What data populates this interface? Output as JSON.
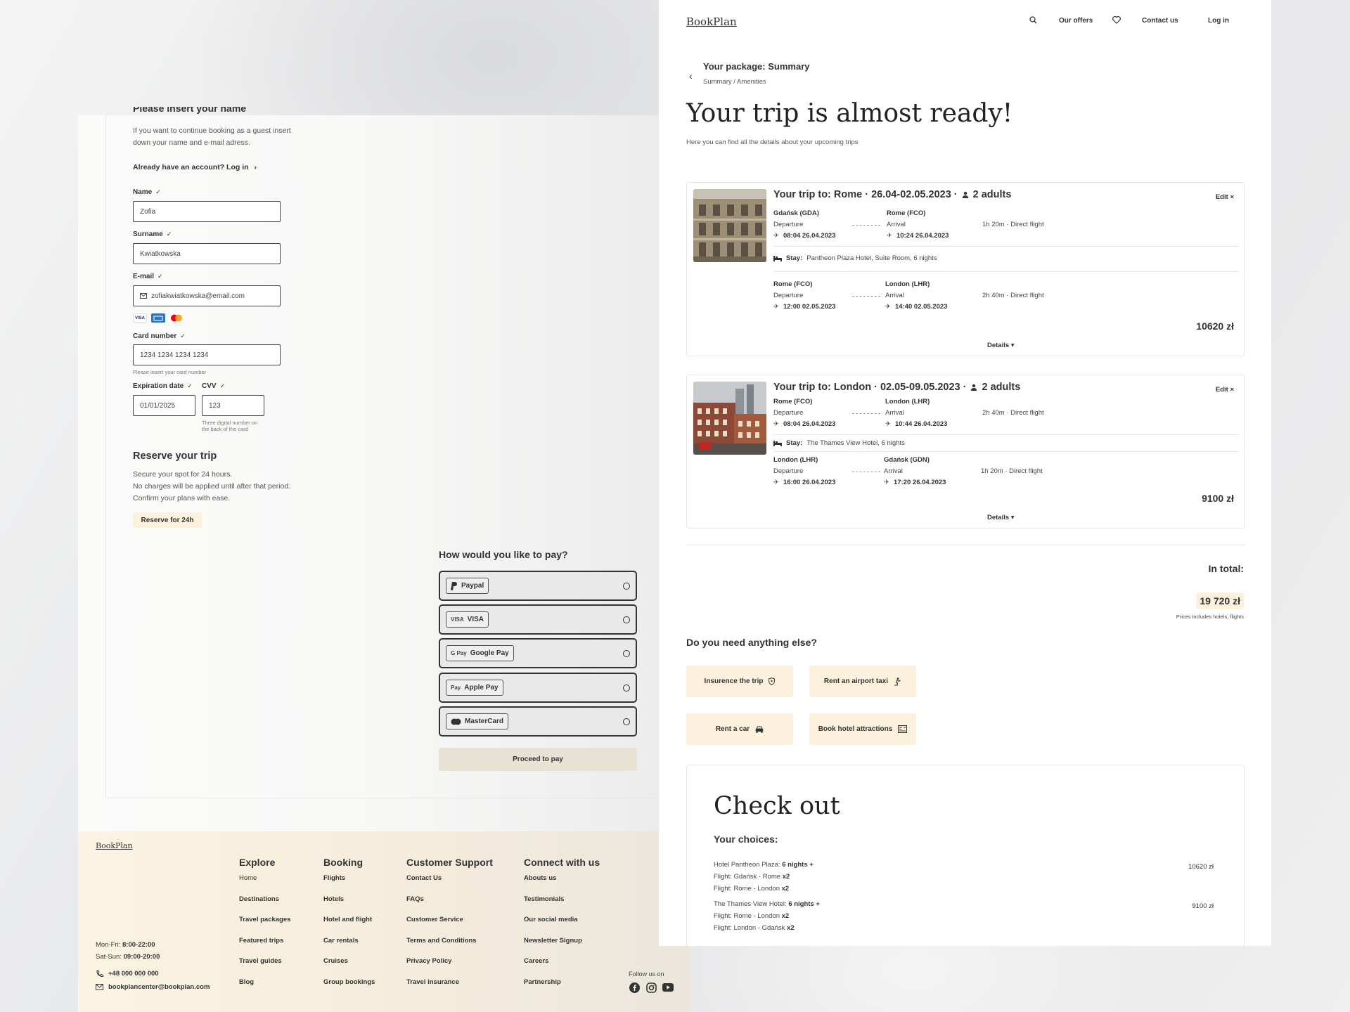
{
  "guest_form": {
    "title": "Please insert your name",
    "intro_line1": "If you want to continue booking as a guest insert",
    "intro_line2": "down your name and e-mail adress.",
    "login_link": "Already have an account? Log in",
    "name_label": "Name",
    "name_value": "Zofia",
    "surname_label": "Surname",
    "surname_value": "Kwiatkowska",
    "email_label": "E-mail",
    "email_value": "zofiakwiatkowska@email.com",
    "card_brands": [
      "VISA",
      "AMEX",
      "MC"
    ],
    "card_label": "Card number",
    "card_value": "1234 1234 1234 1234",
    "card_hint": "Please insert your card number",
    "exp_label": "Expiration date",
    "exp_value": "01/01/2025",
    "cvv_label": "CVV",
    "cvv_value": "123",
    "cvv_hint_line1": "Three digital number on",
    "cvv_hint_line2": "the back of the card",
    "check": "✓"
  },
  "reserve": {
    "title": "Reserve your trip",
    "line1": "Secure your spot for 24 hours.",
    "line2": "No charges will be applied until after that period.",
    "line3": "Confirm your plans with ease.",
    "button": "Reserve for 24h"
  },
  "payment": {
    "title": "How would you like to pay?",
    "options": [
      {
        "label": "Paypal",
        "icon": "paypal-icon"
      },
      {
        "label": "VISA",
        "icon": "visa-icon",
        "prefix": "VISA"
      },
      {
        "label": "Google Pay",
        "icon": "google-pay-icon",
        "prefix": "G Pay"
      },
      {
        "label": "Apple Pay",
        "icon": "apple-pay-icon",
        "prefix": "Pay"
      },
      {
        "label": "MasterCard",
        "icon": "mastercard-icon"
      }
    ],
    "button": "Proceed to pay"
  },
  "footer": {
    "logo": "BookPlan",
    "explore": {
      "title": "Explore",
      "items": [
        "Home",
        "Destinations",
        "Travel packages",
        "Featured trips",
        "Travel guides",
        "Blog"
      ]
    },
    "booking": {
      "title": "Booking",
      "items": [
        "Flights",
        "Hotels",
        "Hotel and flight",
        "Car rentals",
        "Cruises",
        "Group bookings"
      ]
    },
    "support": {
      "title": "Customer Support",
      "items": [
        "Contact Us",
        "FAQs",
        "Customer Service",
        "Terms and Conditions",
        "Privacy Policy",
        "Travel insurance"
      ]
    },
    "connect": {
      "title": "Connect with us",
      "items": [
        "Abouts us",
        "Testimonials",
        "Our social media",
        "Newsletter Signup",
        "Careers",
        "Partnership"
      ]
    },
    "hours_weekday_label": "Mon-Fri:",
    "hours_weekday": "8:00-22:00",
    "hours_weekend_label": "Sat-Sun:",
    "hours_weekend": "09:00-20:00",
    "phone": "+48 000 000 000",
    "email": "bookplancenter@bookplan.com",
    "follow": "Follow us on"
  },
  "nav": {
    "logo": "BookPlan",
    "offers": "Our offers",
    "contact": "Contact us",
    "login": "Log in"
  },
  "package": {
    "title": "Your package: Summary",
    "breadcrumb": "Summary / Amenities",
    "heading": "Your trip is almost ready!",
    "subheading": "Here you can find all the details about your upcoming trips"
  },
  "trips": [
    {
      "title": "Your trip to: Rome · 26.04-02.05.2023 ·",
      "people": "2 adults",
      "edit": "Edit",
      "out": {
        "from": "Gdańsk (GDA)",
        "to": "Rome (FCO)",
        "dep_label": "Departure",
        "arr_label": "Arrival",
        "dep": "08:04  26.04.2023",
        "arr": "10:24  26.04.2023",
        "info": "1h 20m · Direct flight"
      },
      "stay_label": "Stay:",
      "stay": "Pantheon Plaza Hotel, Suite Room, 6 nights",
      "back": {
        "from": "Rome (FCO)",
        "to": "London (LHR)",
        "dep_label": "Departure",
        "arr_label": "Arrival",
        "dep": "12:00  02.05.2023",
        "arr": "14:40  02.05.2023",
        "info": "2h 40m · Direct flight"
      },
      "price": "10620 zł",
      "details": "Details"
    },
    {
      "title": "Your trip to: London · 02.05-09.05.2023 ·",
      "people": "2 adults",
      "edit": "Edit",
      "out": {
        "from": "Rome (FCO)",
        "to": "London (LHR)",
        "dep_label": "Departure",
        "arr_label": "Arrival",
        "dep": "08:04  26.04.2023",
        "arr": "10:44  26.04.2023",
        "info": "2h 40m · Direct flight"
      },
      "stay_label": "Stay:",
      "stay": "The Thames View Hotel, 6 nights",
      "back": {
        "from": "London (LHR)",
        "to": "Gdańsk (GDN)",
        "dep_label": "Departure",
        "arr_label": "Arrival",
        "dep": "16:00  26.04.2023",
        "arr": "17:20  26.04.2023",
        "info": "1h 20m · Direct flight"
      },
      "price": "9100 zł",
      "details": "Details"
    }
  ],
  "summary": {
    "in_total": "In total:",
    "total": "19 720 zł",
    "note": "Prices includes hotels, flights",
    "need_title": "Do you need anything else?",
    "extras": [
      {
        "label": "Insurence the trip",
        "icon": "shield-icon"
      },
      {
        "label": "Rent an airport taxi",
        "icon": "taxi-icon"
      },
      {
        "label": "Rent a car",
        "icon": "car-icon"
      },
      {
        "label": "Book hotel attractions",
        "icon": "attractions-icon"
      }
    ]
  },
  "checkout": {
    "title": "Check out",
    "choices": "Your choices:",
    "item1": {
      "hotel": "Hotel Pantheon Plaza:",
      "hotel_q": "6 nights +",
      "f1": "Flight: Gdańsk - Rome",
      "f1_q": "x2",
      "f2": "Flight: Rome - London",
      "f2_q": "x2",
      "price": "10620 zł"
    },
    "item2": {
      "hotel": "The Thames View Hotel:",
      "hotel_q": "6 nights +",
      "f1": "Flight: Rome - London",
      "f1_q": "x2",
      "f2": "Flight: London - Gdańsk",
      "f2_q": "x2",
      "price": "9100 zł"
    }
  },
  "colors": {
    "accent_cream": "#fbf1dc",
    "dark": "#333333"
  }
}
